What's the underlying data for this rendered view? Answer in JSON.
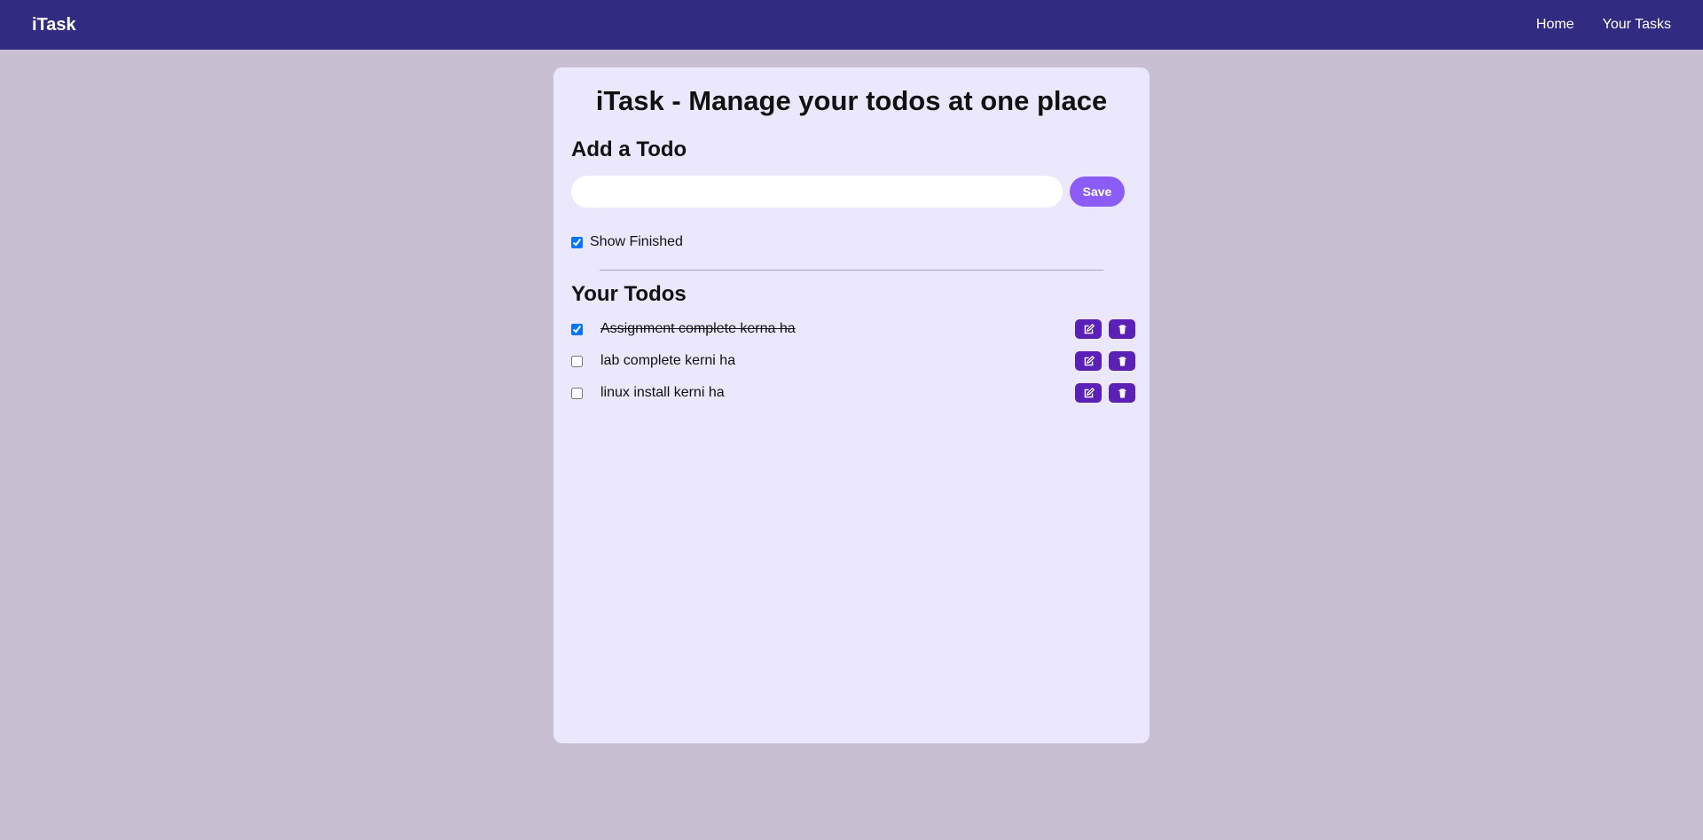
{
  "navbar": {
    "brand": "iTask",
    "links": [
      {
        "label": "Home"
      },
      {
        "label": "Your Tasks"
      }
    ]
  },
  "main": {
    "title": "iTask - Manage your todos at one place",
    "add_heading": "Add a Todo",
    "input": {
      "value": "",
      "placeholder": ""
    },
    "save_label": "Save",
    "show_finished": {
      "label": "Show Finished",
      "checked": true
    },
    "todos_heading": "Your Todos",
    "todos": [
      {
        "text": "Assignment complete kerna ha",
        "completed": true
      },
      {
        "text": "lab complete kerni ha",
        "completed": false
      },
      {
        "text": "linux install kerni ha",
        "completed": false
      }
    ]
  },
  "colors": {
    "navbar": "#312c81",
    "page_background": "#c8bfd2",
    "card_background": "#ebe8fd",
    "save_button": "#8b5cf6",
    "action_button": "#5b21b6"
  },
  "icons": {
    "edit": "edit-icon",
    "delete": "trash-icon"
  }
}
